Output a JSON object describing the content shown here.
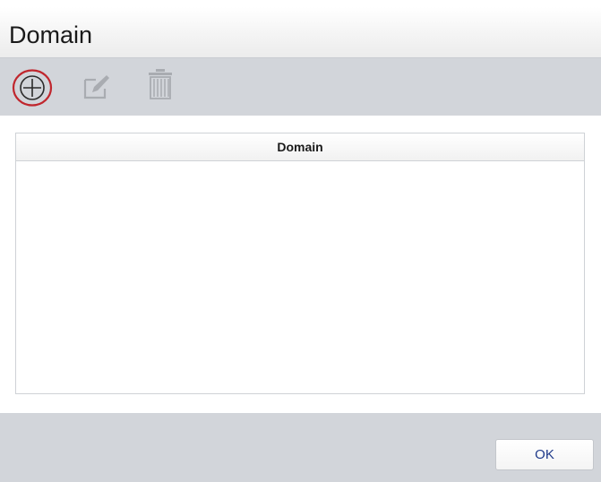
{
  "dialog": {
    "title": "Domain"
  },
  "toolbar": {
    "buttons": [
      {
        "icon": "add-icon",
        "highlighted": true,
        "highlight_color": "#c0262d"
      },
      {
        "icon": "edit-icon",
        "enabled": false
      },
      {
        "icon": "trash-icon",
        "enabled": false
      }
    ]
  },
  "grid": {
    "columns": [
      "Domain"
    ],
    "rows": []
  },
  "footer": {
    "ok_label": "OK"
  },
  "colors": {
    "toolbar_bg": "#d2d5da",
    "footer_bg": "#d2d5da",
    "button_text": "#1f3a8a",
    "disabled_icon": "#a9acb1"
  }
}
